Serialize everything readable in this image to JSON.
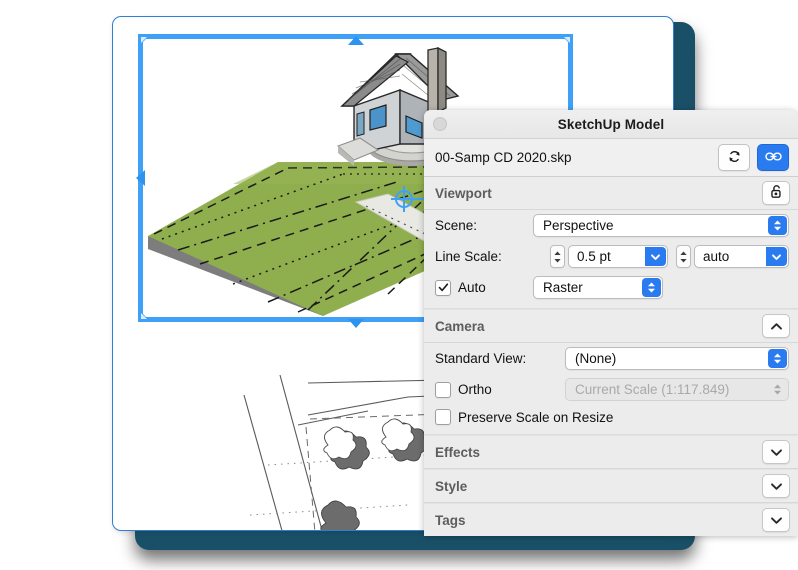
{
  "window": {
    "title": "SketchUp Model",
    "file_name": "00-Samp CD 2020.skp",
    "close_dot": "close-dot",
    "refresh_icon": "refresh-icon",
    "link_icon": "link-icon",
    "unlock_icon": "unlock-icon"
  },
  "sections": {
    "viewport": {
      "title": "Viewport",
      "scene_label": "Scene:",
      "scene_value": "Perspective",
      "line_scale_label": "Line Scale:",
      "line_scale_value": "0.5 pt",
      "line_scale_units": "auto",
      "auto_label": "Auto",
      "auto_checked": true,
      "render_value": "Raster"
    },
    "camera": {
      "title": "Camera",
      "expanded": true,
      "standard_view_label": "Standard View:",
      "standard_view_value": "(None)",
      "ortho_label": "Ortho",
      "ortho_checked": false,
      "scale_value": "Current Scale (1:117.849)",
      "scale_disabled": true,
      "preserve_label": "Preserve Scale on Resize",
      "preserve_checked": false
    },
    "effects": {
      "title": "Effects",
      "expanded": false
    },
    "style": {
      "title": "Style",
      "expanded": false
    },
    "tags": {
      "title": "Tags",
      "expanded": false
    }
  },
  "document": {
    "page_name": "layout-page",
    "viewport_name": "sketchup-model-viewport",
    "siteplan_name": "site-plan-drawing",
    "selection_active": true
  },
  "colors": {
    "accent_blue": "#2a7bf0",
    "selection_blue": "#3ea1f7",
    "backdrop_teal": "#1a5067",
    "panel_grey": "#ececec",
    "grass_green": "#8aa94a"
  }
}
